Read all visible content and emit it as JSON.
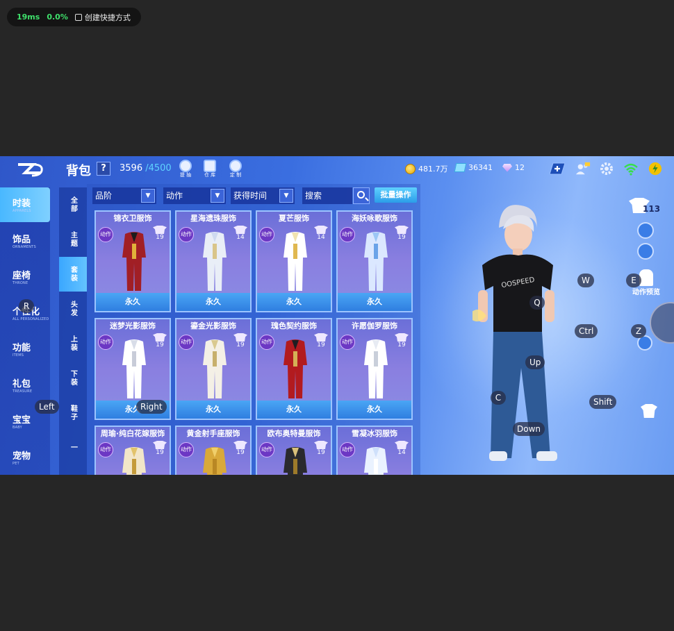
{
  "perf": {
    "latency": "19ms",
    "loss": "0.0%",
    "shortcut": "创建快捷方式"
  },
  "header": {
    "title": "背包",
    "help": "?",
    "capacity_current": "3596",
    "capacity_max": "/4500",
    "icons": [
      {
        "label": "提 抽"
      },
      {
        "label": "仓 库"
      },
      {
        "label": "定 制"
      }
    ],
    "gold": "481.7万",
    "tickets": "36341",
    "diamonds": "12"
  },
  "leftnav": [
    {
      "label": "时装",
      "sub": "APPARELS"
    },
    {
      "label": "饰品",
      "sub": "ORNAMENTS"
    },
    {
      "label": "座椅",
      "sub": "THRONE"
    },
    {
      "label": "个性化",
      "sub": "ALL PERSONALIZED"
    },
    {
      "label": "功能",
      "sub": "ITEMS"
    },
    {
      "label": "礼包",
      "sub": "TREASURE"
    },
    {
      "label": "宝宝",
      "sub": "BABY"
    },
    {
      "label": "宠物",
      "sub": "PET"
    }
  ],
  "subnav": [
    "全部",
    "主题",
    "套装",
    "头发",
    "上装",
    "下装",
    "鞋子",
    "一"
  ],
  "filters": {
    "quality": "品阶",
    "action": "动作",
    "time": "获得时间",
    "search": "搜索",
    "batch": "批量操作"
  },
  "cards": [
    {
      "name": "锦衣卫服饰",
      "tag": "动作",
      "level": "19",
      "status": "永久"
    },
    {
      "name": "星海遗珠服饰",
      "tag": "动作",
      "level": "14",
      "status": "永久"
    },
    {
      "name": "夏芒服饰",
      "tag": "动作",
      "level": "14",
      "status": "永久"
    },
    {
      "name": "海妖咏歌服饰",
      "tag": "动作",
      "level": "19",
      "status": "永久"
    },
    {
      "name": "迷梦光影服饰",
      "tag": "动作",
      "level": "19",
      "status": "永久"
    },
    {
      "name": "鎏金光影服饰",
      "tag": "动作",
      "level": "19",
      "status": "永久"
    },
    {
      "name": "瑰色契约服饰",
      "tag": "动作",
      "level": "19",
      "status": "永久"
    },
    {
      "name": "许愿伽罗服饰",
      "tag": "动作",
      "level": "19",
      "status": "永久"
    },
    {
      "name": "周瑜·纯白花嫁服饰",
      "tag": "动作",
      "level": "19",
      "status": ""
    },
    {
      "name": "黄金射手座服饰",
      "tag": "动作",
      "level": "19",
      "status": ""
    },
    {
      "name": "欧布奥特曼服饰",
      "tag": "动作",
      "level": "19",
      "status": ""
    },
    {
      "name": "雪凝冰羽服饰",
      "tag": "动作",
      "level": "14",
      "status": ""
    }
  ],
  "right": {
    "outfit_count": "113",
    "action_preview": "动作预览"
  },
  "keys": {
    "W": "W",
    "E": "E",
    "Q": "Q",
    "R": "R",
    "Ctrl": "Ctrl",
    "Z": "Z",
    "Up": "Up",
    "C": "C",
    "Shift": "Shift",
    "Left": "Left",
    "Right": "Right",
    "Down": "Down"
  },
  "colors": {
    "accent": "#49b8ff",
    "card": "#7a7ce0",
    "gold": "#f2c100"
  }
}
